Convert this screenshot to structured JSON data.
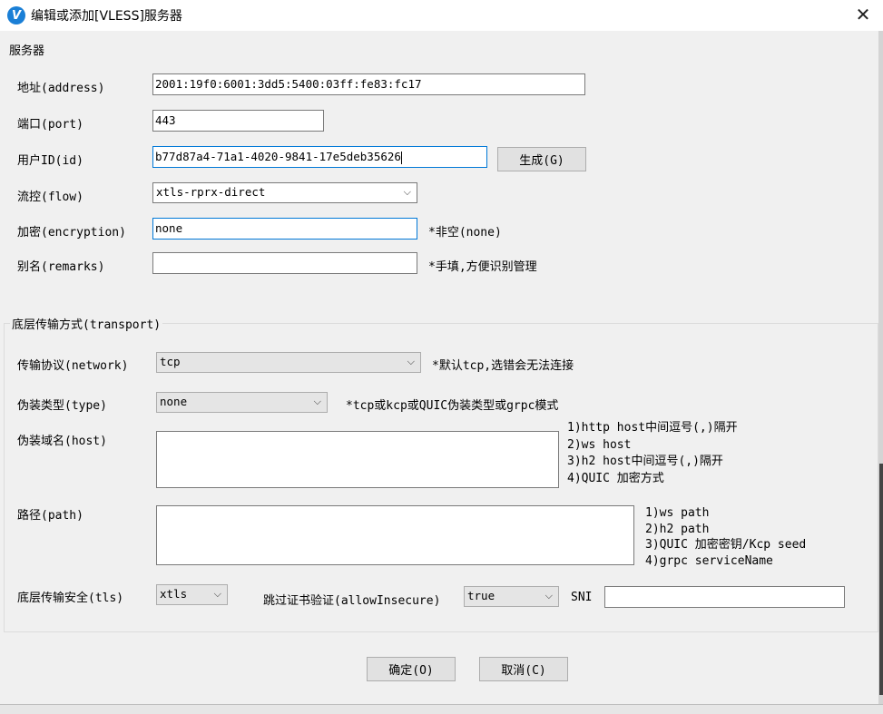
{
  "window": {
    "title": "编辑或添加[VLESS]服务器",
    "app_icon_letter": "V",
    "close_glyph": "✕"
  },
  "server": {
    "group_title": "服务器",
    "address_label": "地址(address)",
    "address_value": "2001:19f0:6001:3dd5:5400:03ff:fe83:fc17",
    "port_label": "端口(port)",
    "port_value": "443",
    "id_label": "用户ID(id)",
    "id_value": "b77d87a4-71a1-4020-9841-17e5deb35626",
    "generate_label": "生成(G)",
    "flow_label": "流控(flow)",
    "flow_value": "xtls-rprx-direct",
    "encryption_label": "加密(encryption)",
    "encryption_value": "none",
    "encryption_hint": "*非空(none)",
    "remarks_label": "别名(remarks)",
    "remarks_value": "",
    "remarks_hint": "*手填,方便识别管理"
  },
  "transport": {
    "group_title": "底层传输方式(transport)",
    "network_label": "传输协议(network)",
    "network_value": "tcp",
    "network_hint": "*默认tcp,选错会无法连接",
    "type_label": "伪装类型(type)",
    "type_value": "none",
    "type_hint": "*tcp或kcp或QUIC伪装类型或grpc模式",
    "host_label": "伪装域名(host)",
    "host_value": "",
    "host_hints": [
      "1)http host中间逗号(,)隔开",
      "2)ws host",
      "3)h2 host中间逗号(,)隔开",
      "4)QUIC 加密方式"
    ],
    "path_label": "路径(path)",
    "path_value": "",
    "path_hints": [
      "1)ws path",
      "2)h2 path",
      "3)QUIC 加密密钥/Kcp seed",
      "4)grpc serviceName"
    ],
    "tls_label": "底层传输安全(tls)",
    "tls_value": "xtls",
    "allow_insecure_label": "跳过证书验证(allowInsecure)",
    "allow_insecure_value": "true",
    "sni_label": "SNI",
    "sni_value": ""
  },
  "footer": {
    "ok_label": "确定(O)",
    "cancel_label": "取消(C)"
  },
  "icons": {
    "dropdown": "chevron-down-icon",
    "close": "close-icon"
  },
  "colors": {
    "accent": "#0078d7",
    "app_icon": "#1a7fd6"
  }
}
